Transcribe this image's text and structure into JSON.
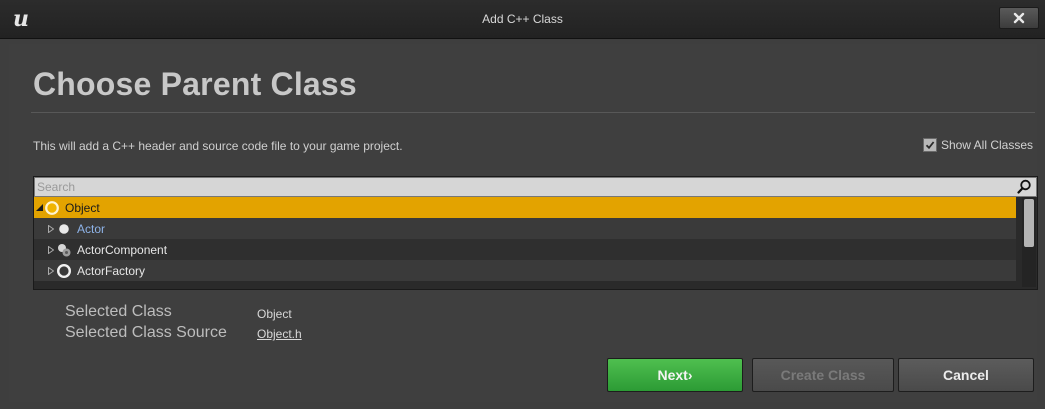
{
  "window": {
    "title": "Add C++ Class",
    "logo_glyph": "u"
  },
  "header": {
    "heading": "Choose Parent Class",
    "description": "This will add a C++ header and source code file to your game project.",
    "show_all_classes_label": "Show All Classes",
    "show_all_classes_checked": true
  },
  "search": {
    "placeholder": "Search",
    "value": ""
  },
  "tree": {
    "items": [
      {
        "label": "Object",
        "icon": "object-class-icon",
        "expanded": true,
        "selected": true
      },
      {
        "label": "Actor",
        "icon": "actor-class-icon",
        "expanded": false,
        "selected": false
      },
      {
        "label": "ActorComponent",
        "icon": "actor-component-icon",
        "expanded": false,
        "selected": false
      },
      {
        "label": "ActorFactory",
        "icon": "actor-factory-icon",
        "expanded": false,
        "selected": false
      }
    ]
  },
  "selection": {
    "class_label": "Selected Class",
    "class_value": "Object",
    "source_label": "Selected Class Source",
    "source_value": "Object.h"
  },
  "buttons": {
    "next": "Next",
    "next_suffix": "›",
    "create": "Create Class",
    "cancel": "Cancel"
  },
  "colors": {
    "selected_row": "#e3a300",
    "next_button": "#2c9b35",
    "actor_text": "#8eb3e8"
  }
}
